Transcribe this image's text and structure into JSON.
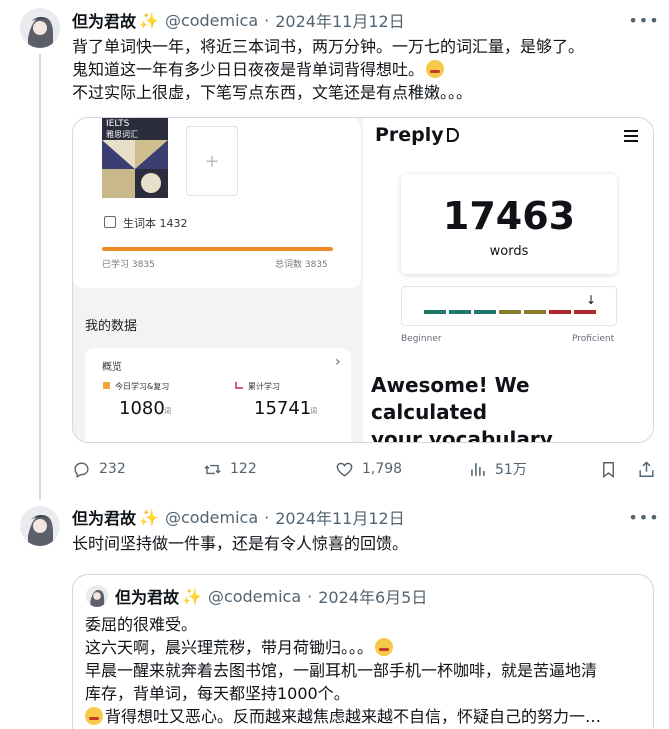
{
  "tweets": [
    {
      "author": "但为君故",
      "handle": "@codemica",
      "date": "2024年11月12日",
      "lines": [
        "背了单词快一年，将近三本词书，两万分钟。一万七的词汇量，是够了。",
        "鬼知道这一年有多少日日夜夜是背单词背得想吐。",
        "不过实际上很虚，下笔写点东西，文笔还是有点稚嫩。。。"
      ],
      "actions": {
        "replies": "232",
        "retweets": "122",
        "likes": "1,798",
        "views": "51万"
      }
    },
    {
      "author": "但为君故",
      "handle": "@codemica",
      "date": "2024年11月12日",
      "lines": [
        "长时间坚持做一件事，还是有令人惊喜的回馈。"
      ]
    }
  ],
  "media": {
    "left": {
      "book_title": "IELTS",
      "book_subtitle": "雅思词汇",
      "plus": "+",
      "vocab_book": "生词本 1432",
      "learned": "已学习 3835",
      "total": "总词数 3835",
      "section_title": "我的数据",
      "overview": "概览",
      "chevron": "›",
      "today_label": "今日学习&复习",
      "today_value": "1080",
      "today_unit": "词",
      "cumulative_label": "累计学习",
      "cumulative_value": "15741",
      "cumulative_unit": "词"
    },
    "right": {
      "logo": "Preply",
      "vocab_count": "17463",
      "vocab_unit": "words",
      "level_start": "Beginner",
      "level_end": "Proficient",
      "headline_1": "Awesome! We calculated",
      "headline_2": "your vocabulary",
      "segment_colors": [
        "#1f7a6b",
        "#1f7a6b",
        "#1f7a6b",
        "#8a7a2a",
        "#8a7a2a",
        "#b0282b",
        "#b0282b"
      ]
    }
  },
  "quote": {
    "author": "但为君故",
    "handle": "@codemica",
    "date": "2024年6月5日",
    "lines": [
      "委屈的很难受。",
      "这六天啊，晨兴理荒秽，带月荷锄归。。。",
      "早晨一醒来就奔着去图书馆，一副耳机一部手机一杯咖啡，就是苦逼地清",
      "库存，背单词，每天都坚持1000个。",
      "背得想吐又恶心。反而越来越焦虑越来越不自信，怀疑自己的努力一…"
    ]
  },
  "colors": {
    "text": "#0f1419",
    "secondary": "#536471",
    "border": "#cfd9de",
    "progress": "#f08a24"
  }
}
